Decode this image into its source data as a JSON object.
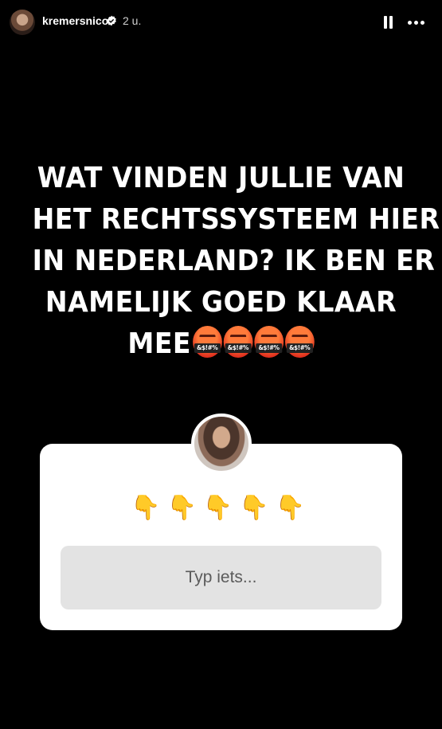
{
  "header": {
    "username": "kremersnicol",
    "time": "2 u.",
    "verified": true,
    "pause_icon": "pause-icon",
    "more_icon": "more-options-icon"
  },
  "caption": {
    "lines": [
      "WAT VINDEN JULLIE VAN",
      "HET RECHTSSYSTEEM HIER",
      "IN NEDERLAND? IK BEN ER",
      "NAMELIJK GOED KLAAR",
      "MEE"
    ],
    "emoji": [
      "🤬",
      "🤬",
      "🤬",
      "🤬"
    ]
  },
  "question_sticker": {
    "emoji_prompt": [
      "👇",
      "👇",
      "👇",
      "👇",
      "👇"
    ],
    "input_placeholder": "Typ iets..."
  },
  "colors": {
    "background": "#000000",
    "card": "#ffffff",
    "input": "#e3e3e3",
    "verified_badge": "#ffffff"
  }
}
